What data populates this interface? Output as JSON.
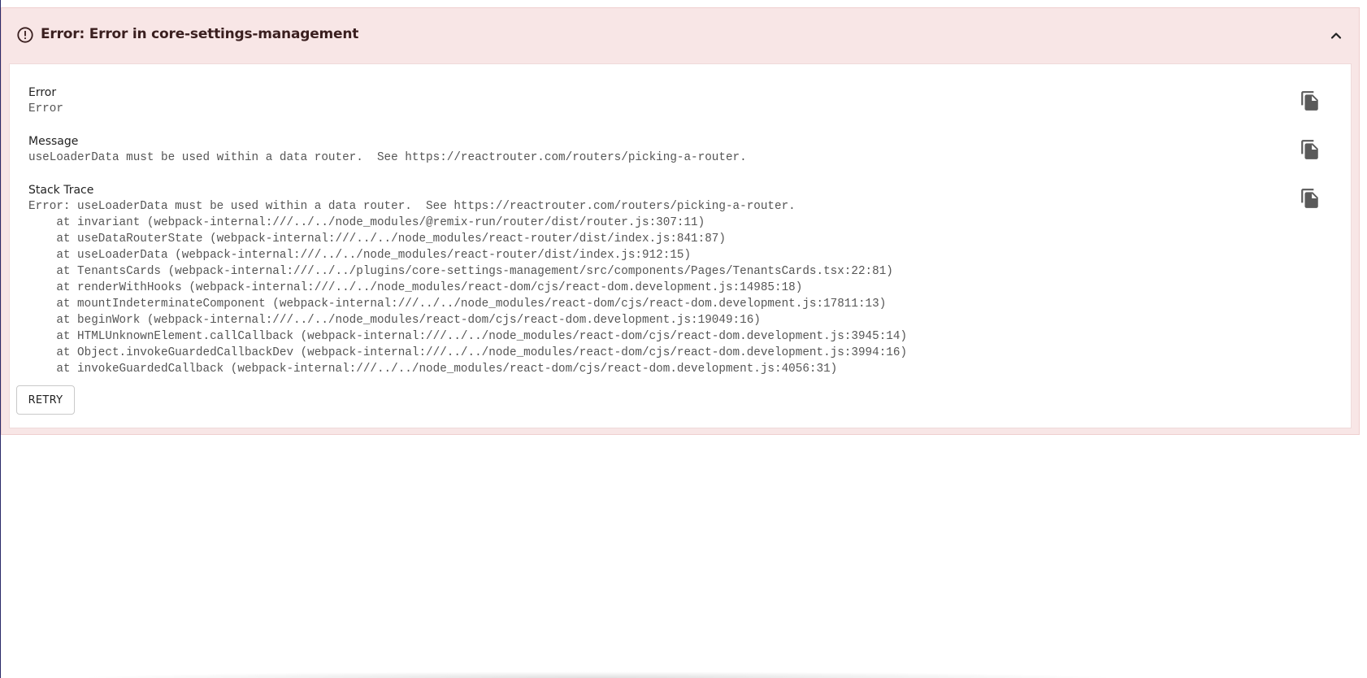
{
  "header": {
    "title": "Error: Error in core-settings-management",
    "icon": "alert-circle-icon",
    "collapse_icon": "chevron-up-icon"
  },
  "fields": {
    "error": {
      "label": "Error",
      "value": "Error"
    },
    "message": {
      "label": "Message",
      "value": "useLoaderData must be used within a data router.  See https://reactrouter.com/routers/picking-a-router."
    },
    "stack": {
      "label": "Stack Trace",
      "value": "Error: useLoaderData must be used within a data router.  See https://reactrouter.com/routers/picking-a-router.\n    at invariant (webpack-internal:///../../node_modules/@remix-run/router/dist/router.js:307:11)\n    at useDataRouterState (webpack-internal:///../../node_modules/react-router/dist/index.js:841:87)\n    at useLoaderData (webpack-internal:///../../node_modules/react-router/dist/index.js:912:15)\n    at TenantsCards (webpack-internal:///../../plugins/core-settings-management/src/components/Pages/TenantsCards.tsx:22:81)\n    at renderWithHooks (webpack-internal:///../../node_modules/react-dom/cjs/react-dom.development.js:14985:18)\n    at mountIndeterminateComponent (webpack-internal:///../../node_modules/react-dom/cjs/react-dom.development.js:17811:13)\n    at beginWork (webpack-internal:///../../node_modules/react-dom/cjs/react-dom.development.js:19049:16)\n    at HTMLUnknownElement.callCallback (webpack-internal:///../../node_modules/react-dom/cjs/react-dom.development.js:3945:14)\n    at Object.invokeGuardedCallbackDev (webpack-internal:///../../node_modules/react-dom/cjs/react-dom.development.js:3994:16)\n    at invokeGuardedCallback (webpack-internal:///../../node_modules/react-dom/cjs/react-dom.development.js:4056:31)"
    }
  },
  "actions": {
    "retry_label": "RETRY",
    "copy_icon": "copy-icon"
  },
  "colors": {
    "panel_bg": "#f8e6e6",
    "title": "#3a1f1f",
    "mono_text": "#555555"
  }
}
